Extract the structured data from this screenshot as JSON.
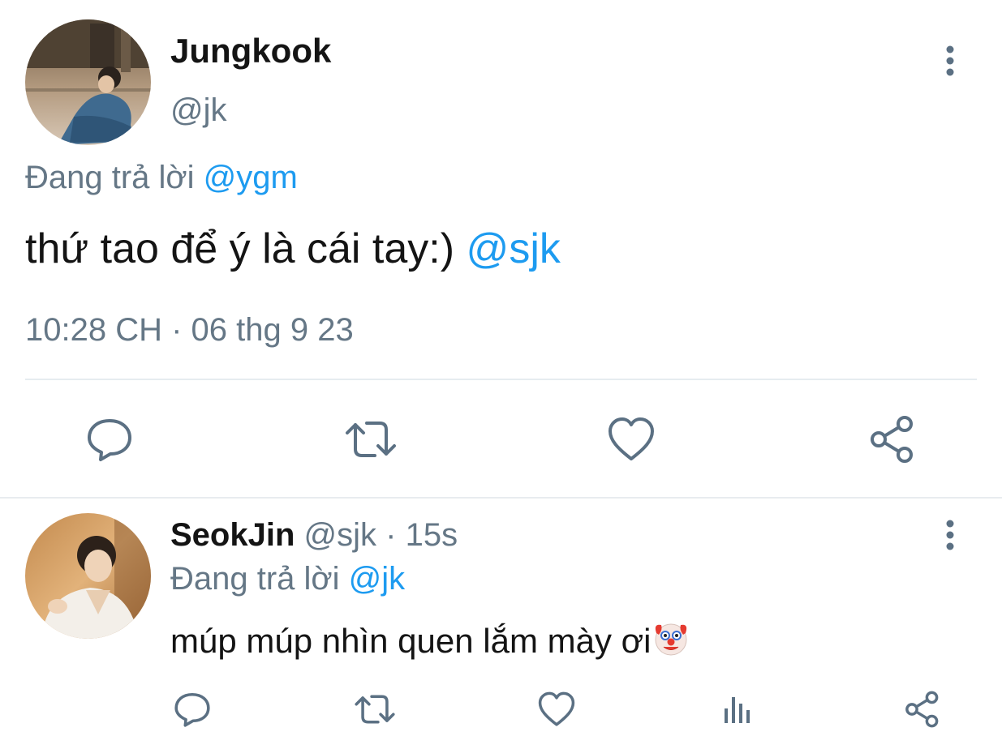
{
  "main_tweet": {
    "display_name": "Jungkook",
    "handle": "@jk",
    "reply_prefix": "Đang trả lời",
    "reply_to": "@ygm",
    "text": "thứ tao để ý là cái tay:)",
    "mention": "@sjk",
    "timestamp": "10:28 CH · 06 thg 9 23",
    "actions": [
      "reply-icon",
      "retweet-icon",
      "like-icon",
      "share-icon"
    ]
  },
  "reply_tweet": {
    "display_name": "SeokJin",
    "handle": "@sjk",
    "separator": "·",
    "time_ago": "15s",
    "reply_prefix": "Đang trả lời",
    "reply_to": "@jk",
    "text": "múp múp nhìn quen lắm mày ơi",
    "emoji": "clown-face",
    "actions": [
      "reply-icon",
      "retweet-icon",
      "like-icon",
      "analytics-icon",
      "share-icon"
    ]
  },
  "colors": {
    "accent": "#1d9bf0",
    "muted_text": "#657786",
    "icon": "#5b7083",
    "divider": "#e6ecf0"
  }
}
